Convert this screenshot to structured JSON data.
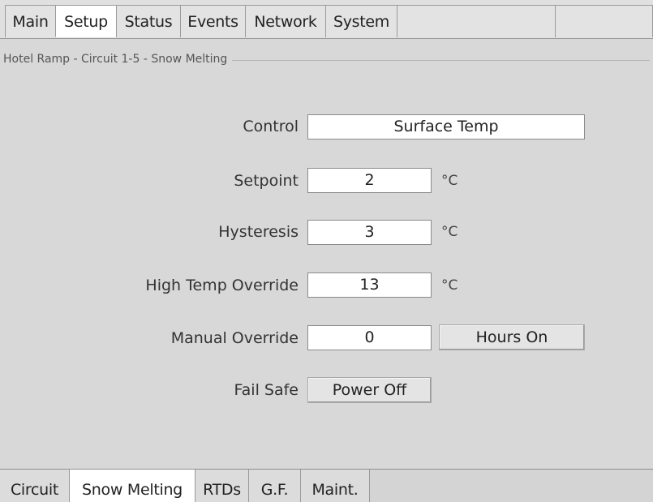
{
  "top_tabs": {
    "main": "Main",
    "setup": "Setup",
    "status": "Status",
    "events": "Events",
    "network": "Network",
    "system": "System"
  },
  "group": {
    "title": "Hotel Ramp - Circuit 1-5 - Snow Melting"
  },
  "form": {
    "control": {
      "label": "Control",
      "value": "Surface Temp"
    },
    "setpoint": {
      "label": "Setpoint",
      "value": "2",
      "unit": "°C"
    },
    "hysteresis": {
      "label": "Hysteresis",
      "value": "3",
      "unit": "°C"
    },
    "high_temp_override": {
      "label": "High Temp Override",
      "value": "13",
      "unit": "°C"
    },
    "manual_override": {
      "label": "Manual Override",
      "value": "0",
      "mode_button": "Hours On"
    },
    "fail_safe": {
      "label": "Fail Safe",
      "value": "Power Off"
    }
  },
  "bottom_tabs": {
    "circuit": "Circuit",
    "snow_melting": "Snow Melting",
    "rtds": "RTDs",
    "gf": "G.F.",
    "maint": "Maint."
  },
  "active_top_tab": "Setup",
  "active_bottom_tab": "Snow Melting"
}
